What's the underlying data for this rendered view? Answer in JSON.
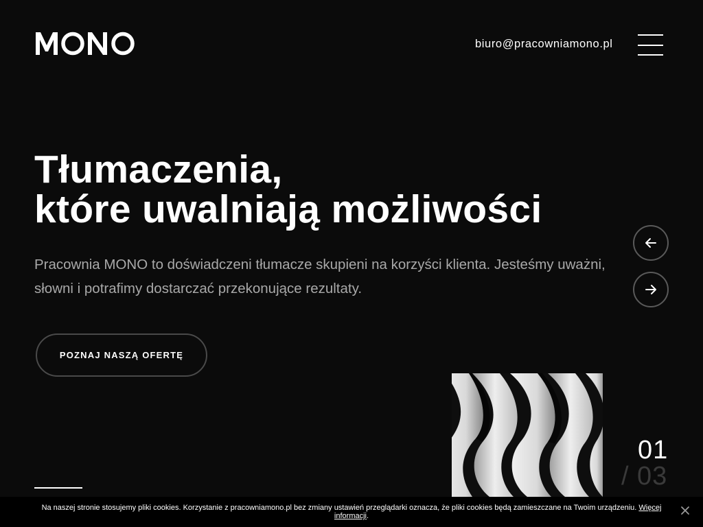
{
  "header": {
    "logo_text": "MONO",
    "email": "biuro@pracowniamono.pl",
    "menu_icon": "hamburger-icon"
  },
  "hero": {
    "title_line1": "Tłumaczenia,",
    "title_line2": "które uwalniają możliwości",
    "description": "Pracownia MONO to doświadczeni tłumacze skupieni na korzyści klienta. Jesteśmy uważni, słowni i potrafimy dostarczać przekonujące rezultaty.",
    "cta_label": "POZNAJ NASZĄ OFERTĘ"
  },
  "slider": {
    "prev_icon": "arrow-left-icon",
    "next_icon": "arrow-right-icon",
    "current": "01",
    "separator": "/",
    "total": "03"
  },
  "cookie": {
    "text": "Na naszej stronie stosujemy pliki cookies. Korzystanie z pracowniamono.pl bez zmiany ustawień przeglądarki oznacza, że pliki cookies będą zamieszczane na Twoim urządzeniu.",
    "link_label": "Więcej informacji",
    "link_suffix": ".",
    "close_icon": "close-icon"
  },
  "colors": {
    "background": "#0b0b0b",
    "text": "#ffffff",
    "muted_text": "#a9a9a9",
    "counter_muted": "#3a3a3a",
    "cookie_bar": "#000000"
  }
}
